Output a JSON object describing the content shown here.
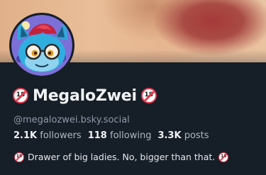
{
  "profile": {
    "display_name": "MegaloZwei",
    "name_badge_left": "18",
    "name_badge_right": "18",
    "handle": "@megalozwei.bsky.social",
    "bio_badge": "18",
    "bio": "Drawer of big ladies. No, bigger than that.",
    "avatar_icon": "avatar-illustration"
  },
  "stats": {
    "followers_value": "2.1K",
    "followers_label": "followers",
    "following_value": "118",
    "following_label": "following",
    "posts_value": "3.3K",
    "posts_label": "posts"
  },
  "colors": {
    "background": "#161e27",
    "text": "#f1f3f5",
    "muted": "#8f9aa8",
    "badge_red": "#e8364b"
  }
}
